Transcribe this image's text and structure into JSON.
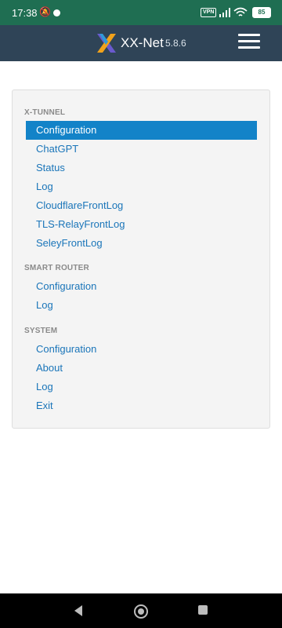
{
  "status_bar": {
    "time": "17:38",
    "vpn_label": "VPN",
    "battery": "85"
  },
  "app_bar": {
    "title": "XX-Net",
    "version": "5.8.6"
  },
  "sections": {
    "x_tunnel": {
      "title": "X-TUNNEL",
      "items": [
        "Configuration",
        "ChatGPT",
        "Status",
        "Log",
        "CloudflareFrontLog",
        "TLS-RelayFrontLog",
        "SeleyFrontLog"
      ]
    },
    "smart_router": {
      "title": "SMART ROUTER",
      "items": [
        "Configuration",
        "Log"
      ]
    },
    "system": {
      "title": "SYSTEM",
      "items": [
        "Configuration",
        "About",
        "Log",
        "Exit"
      ]
    }
  },
  "colors": {
    "status_bar_bg": "#1f6e52",
    "app_bar_bg": "#2f4457",
    "active_item_bg": "#1383c8",
    "link_color": "#1a75b9"
  }
}
